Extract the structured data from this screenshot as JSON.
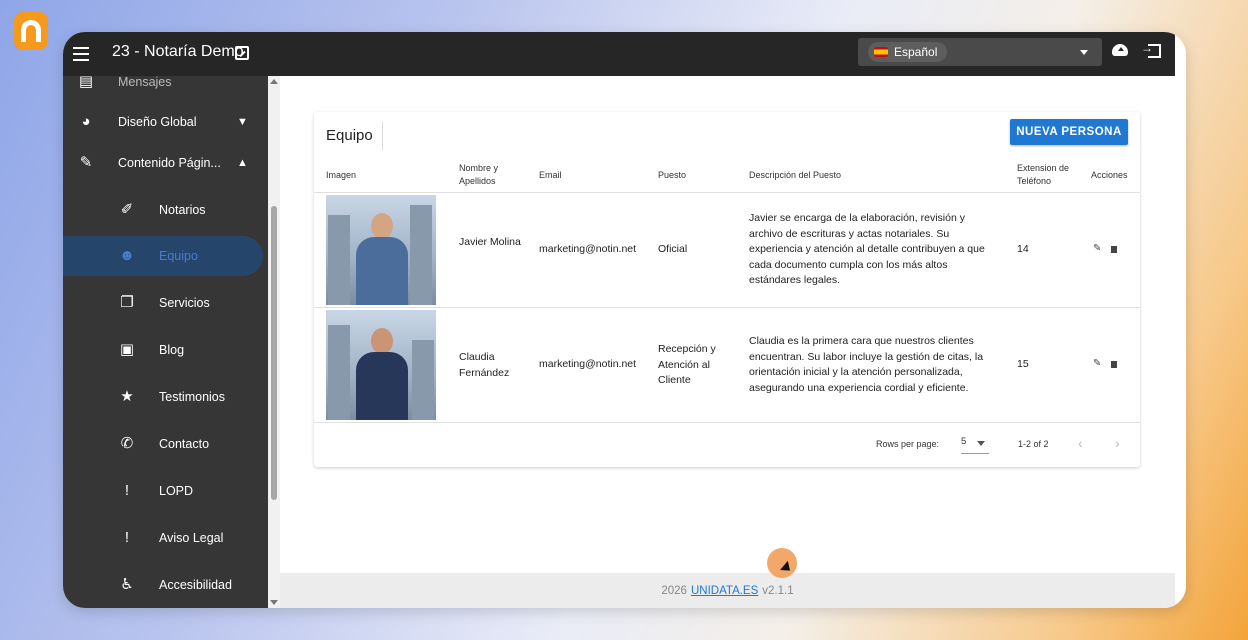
{
  "app": {
    "title": "23 - Notaría Demo"
  },
  "language": {
    "selected": "Español"
  },
  "sidebar": {
    "partial_item": "Mensajes",
    "items": [
      {
        "label": "Diseño Global",
        "icon": "palette-icon",
        "expanded": false
      },
      {
        "label": "Contenido Págin...",
        "icon": "edit-document-icon",
        "expanded": true
      },
      {
        "label": "Notarios",
        "icon": "person-edit-icon"
      },
      {
        "label": "Equipo",
        "icon": "group-icon",
        "active": true
      },
      {
        "label": "Servicios",
        "icon": "documents-icon"
      },
      {
        "label": "Blog",
        "icon": "article-icon"
      },
      {
        "label": "Testimonios",
        "icon": "star-icon"
      },
      {
        "label": "Contacto",
        "icon": "phone-icon"
      },
      {
        "label": "LOPD",
        "icon": "alert-icon"
      },
      {
        "label": "Aviso Legal",
        "icon": "alert-icon"
      },
      {
        "label": "Accesibilidad",
        "icon": "accessibility-icon"
      }
    ]
  },
  "card": {
    "title": "Equipo",
    "new_button": "NUEVA PERSONA",
    "columns": {
      "image": "Imagen",
      "name": "Nombre y Apellidos",
      "email": "Email",
      "position": "Puesto",
      "description": "Descripción del Puesto",
      "extension": "Extension de Teléfono",
      "actions": "Acciones"
    },
    "rows": [
      {
        "name": "Javier Molina",
        "email": "marketing@notin.net",
        "position": "Oficial",
        "description": "Javier se encarga de la elaboración, revisión y archivo de escrituras y actas notariales. Su experiencia y atención al detalle contribuyen a que cada documento cumpla con los más altos estándares legales.",
        "extension": "14"
      },
      {
        "name": "Claudia Fernández",
        "email": "marketing@notin.net",
        "position": "Recepción y Atención al Cliente",
        "description": "Claudia es la primera cara que nuestros clientes encuentran. Su labor incluye la gestión de citas, la orientación inicial y la atención personalizada, asegurando una experiencia cordial y eficiente.",
        "extension": "15"
      }
    ],
    "pagination": {
      "rows_per_page_label": "Rows per page:",
      "rows_per_page_value": "5",
      "range": "1-2 of 2"
    }
  },
  "footer": {
    "year": "2026",
    "link": "UNIDATA.ES",
    "version": "v2.1.1"
  },
  "colors": {
    "accent": "#1f78d1",
    "topbar": "#262626",
    "sidebar": "#363636",
    "brand": "#f59a1d"
  }
}
